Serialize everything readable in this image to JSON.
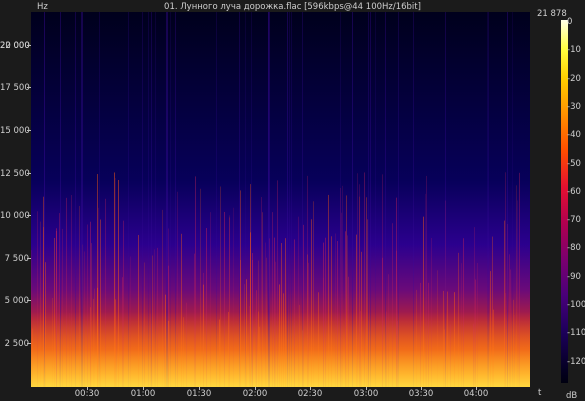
{
  "window": {
    "title": "01. Лунного луча дорожка.flac [596kbps@44 100Hz/16bit]"
  },
  "spectrogram": {
    "freq_unit": "Hz",
    "freq_max_label": "21 878",
    "freq_ticks": [
      "22 000",
      "20 000",
      "17 500",
      "15 000",
      "12 500",
      "10 000",
      "7 500",
      "5 000",
      "2 500"
    ],
    "time_unit": "t",
    "time_ticks": [
      "00:30",
      "01:00",
      "01:30",
      "02:00",
      "02:30",
      "03:00",
      "03:30",
      "04:00"
    ],
    "db_unit": "dB",
    "db_ticks": [
      "0",
      "-10",
      "-20",
      "-30",
      "-40",
      "-50",
      "-60",
      "-70",
      "-80",
      "-90",
      "-100",
      "-110",
      "-120"
    ],
    "colors": {
      "background": "#1b1b1b",
      "low_energy": "#00002a",
      "mid_energy": "#3b0a8a",
      "high_energy": "#e0301e",
      "peak_energy": "#ffd23a"
    }
  }
}
